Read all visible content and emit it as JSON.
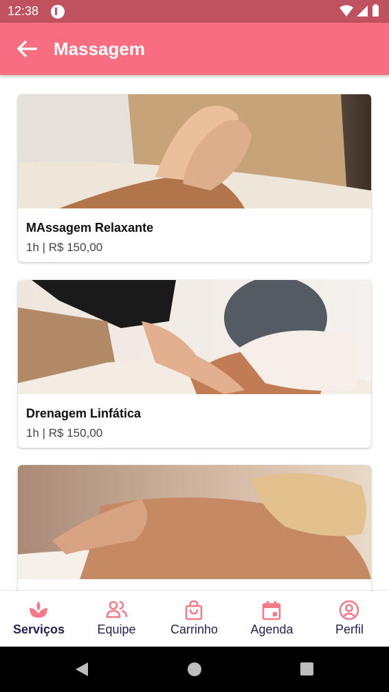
{
  "status_bar": {
    "time": "12:38"
  },
  "app_bar": {
    "title": "Massagem"
  },
  "services": [
    {
      "name": "MAssagem Relaxante",
      "info": "1h | R$ 150,00"
    },
    {
      "name": "Drenagem Linfática",
      "info": "1h | R$ 150,00"
    },
    {
      "name": "",
      "info": ""
    }
  ],
  "bottom_nav": {
    "items": [
      {
        "label": "Serviços",
        "icon": "spa-icon",
        "active": true
      },
      {
        "label": "Equipe",
        "icon": "people-icon",
        "active": false
      },
      {
        "label": "Carrinho",
        "icon": "shopping-bag-icon",
        "active": false
      },
      {
        "label": "Agenda",
        "icon": "calendar-icon",
        "active": false
      },
      {
        "label": "Perfil",
        "icon": "profile-icon",
        "active": false
      }
    ]
  },
  "colors": {
    "status_bar": "#c0515f",
    "app_bar": "#f76e80",
    "nav_icon": "#f47a8a",
    "nav_label": "#23234e"
  }
}
